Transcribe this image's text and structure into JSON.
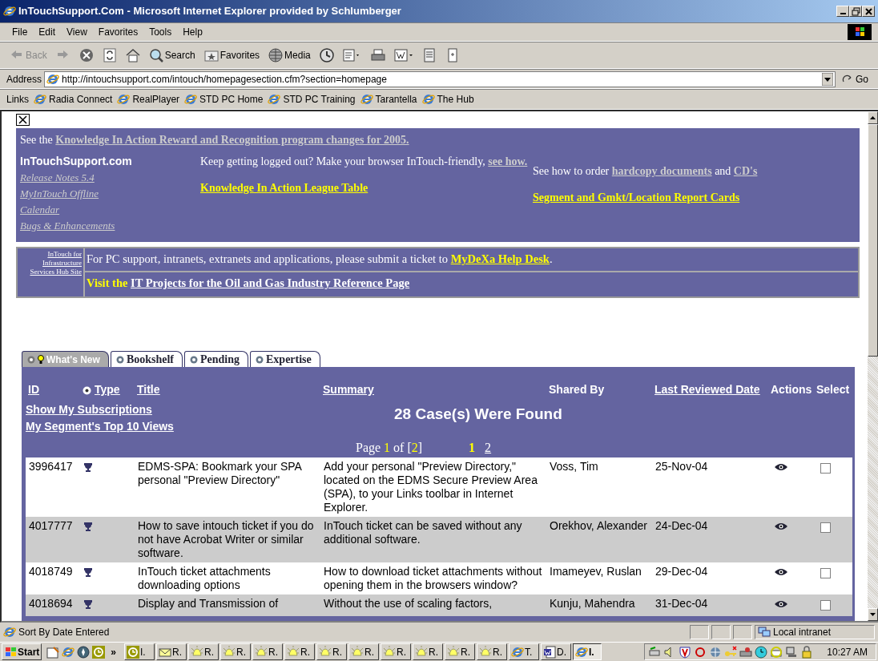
{
  "window": {
    "title": "InTouchSupport.Com - Microsoft Internet Explorer provided by Schlumberger"
  },
  "menu": [
    "File",
    "Edit",
    "View",
    "Favorites",
    "Tools",
    "Help"
  ],
  "toolbar": [
    {
      "kind": "back",
      "label": "Back"
    },
    {
      "kind": "forward"
    },
    {
      "kind": "stop"
    },
    {
      "kind": "refresh"
    },
    {
      "kind": "home"
    },
    {
      "kind": "search",
      "label": "Search"
    },
    {
      "kind": "favorites",
      "label": "Favorites"
    },
    {
      "kind": "media",
      "label": "Media"
    },
    {
      "kind": "history"
    },
    {
      "kind": "mail"
    },
    {
      "kind": "print"
    },
    {
      "kind": "edit"
    },
    {
      "kind": "discuss"
    },
    {
      "kind": "messenger"
    }
  ],
  "address": {
    "label": "Address",
    "url": "http://intouchsupport.com/intouch/homepagesection.cfm?section=homepage",
    "go": "Go"
  },
  "links_bar": {
    "label": "Links",
    "items": [
      "Radia Connect",
      "RealPlayer",
      "STD PC Home",
      "STD PC Training",
      "Tarantella",
      "The Hub"
    ]
  },
  "announcement": {
    "text": "See the",
    "link": "Knowledge In Action Reward and Recognition program changes for 2005."
  },
  "quick_links": {
    "heading": "InTouchSupport.com",
    "items": [
      "Release Notes 5.4",
      "MyInTouch Offline",
      "Calendar",
      "Bugs & Enhancements"
    ]
  },
  "login_notice": {
    "text": "Keep getting logged out? Make your browser InTouch-friendly,",
    "link": "see how."
  },
  "league_link": "Knowledge In Action League Table",
  "order_notice": {
    "text": "See how to order",
    "link_1": "hardcopy documents",
    "joiner": "and",
    "link_2": "CD's"
  },
  "report_cards_link": "Segment and Gmkt/Location Report Cards",
  "infra": {
    "side_link": "InTouch for Infrastructure Services Hub Site",
    "text": "For PC support, intranets, extranets and applications, please submit a ticket to",
    "link": "MyDeXa Help Desk",
    "after": ".",
    "visit_text": "Visit the",
    "visit_link": "IT Projects for the Oil and Gas Industry Reference Page"
  },
  "tabs": [
    {
      "label": "What's New",
      "selected": true
    },
    {
      "label": "Bookshelf",
      "selected": false
    },
    {
      "label": "Pending",
      "selected": false
    },
    {
      "label": "Expertise",
      "selected": false
    }
  ],
  "table": {
    "columns": [
      {
        "label": "ID",
        "link": true
      },
      {
        "label": "Type",
        "link": true
      },
      {
        "label": "Title",
        "link": true
      },
      {
        "label": "Summary",
        "link": true
      },
      {
        "label": "Shared By",
        "link": false
      },
      {
        "label": "Last Reviewed Date",
        "link": true
      },
      {
        "label": "Actions",
        "link": false
      },
      {
        "label": "Select",
        "link": false
      }
    ],
    "side_links": [
      "Show My Subscriptions",
      "My Segment's Top 10 Views"
    ],
    "found": "28 Case(s) Were Found",
    "pager": {
      "label": "Page",
      "current": "1",
      "of": "of [",
      "total": "2",
      "close": "]",
      "pages": [
        {
          "label": "1",
          "selected": true
        },
        {
          "label": "2",
          "selected": false
        }
      ]
    },
    "rows": [
      {
        "id": "3996417",
        "title": "EDMS-SPA: Bookmark your SPA personal \"Preview Directory\"",
        "summary": "Add your personal \"Preview Directory,\" located on the EDMS Secure Preview Area (SPA), to your Links toolbar in Internet Explorer.",
        "shared_by": "Voss, Tim",
        "date": "25-Nov-04",
        "checked": false
      },
      {
        "id": "4017777",
        "title": "How to save intouch ticket if you do not have Acrobat Writer or similar software.",
        "summary": "InTouch ticket can be saved without any additional software.",
        "shared_by": "Orekhov, Alexander",
        "date": "24-Dec-04",
        "checked": false
      },
      {
        "id": "4018749",
        "title": "InTouch ticket attachments downloading options",
        "summary": "How to download ticket attachments without opening them in the browsers window?",
        "shared_by": "Imameyev, Ruslan",
        "date": "29-Dec-04",
        "checked": false
      },
      {
        "id": "4018694",
        "title": "Display and Transmission of",
        "summary": "Without the use of scaling factors,",
        "shared_by": "Kunju, Mahendra",
        "date": "31-Dec-04",
        "checked": false
      }
    ]
  },
  "status_bar": {
    "text": "Sort By Date Entered",
    "zone": "Local intranet"
  },
  "taskbar": {
    "start": "Start",
    "tasks": [
      {
        "kind": "clock",
        "label": "I.",
        "selected": false
      },
      {
        "kind": "mail",
        "label": "R.",
        "selected": false
      },
      {
        "kind": "bell",
        "label": "R.",
        "selected": false
      },
      {
        "kind": "bell",
        "label": "R.",
        "selected": false
      },
      {
        "kind": "bell",
        "label": "R.",
        "selected": false
      },
      {
        "kind": "bell",
        "label": "R.",
        "selected": false
      },
      {
        "kind": "bell",
        "label": "R.",
        "selected": false
      },
      {
        "kind": "bell",
        "label": "R.",
        "selected": false
      },
      {
        "kind": "bell",
        "label": "R.",
        "selected": false
      },
      {
        "kind": "bell",
        "label": "R.",
        "selected": false
      },
      {
        "kind": "bell",
        "label": "R.",
        "selected": false
      },
      {
        "kind": "bell",
        "label": "R.",
        "selected": false
      },
      {
        "kind": "ie",
        "label": "T.",
        "selected": false
      },
      {
        "kind": "word",
        "label": "D.",
        "selected": false
      },
      {
        "kind": "ie",
        "label": "I.",
        "selected": true
      }
    ],
    "chevron": "»",
    "clock": "10:27 AM"
  }
}
